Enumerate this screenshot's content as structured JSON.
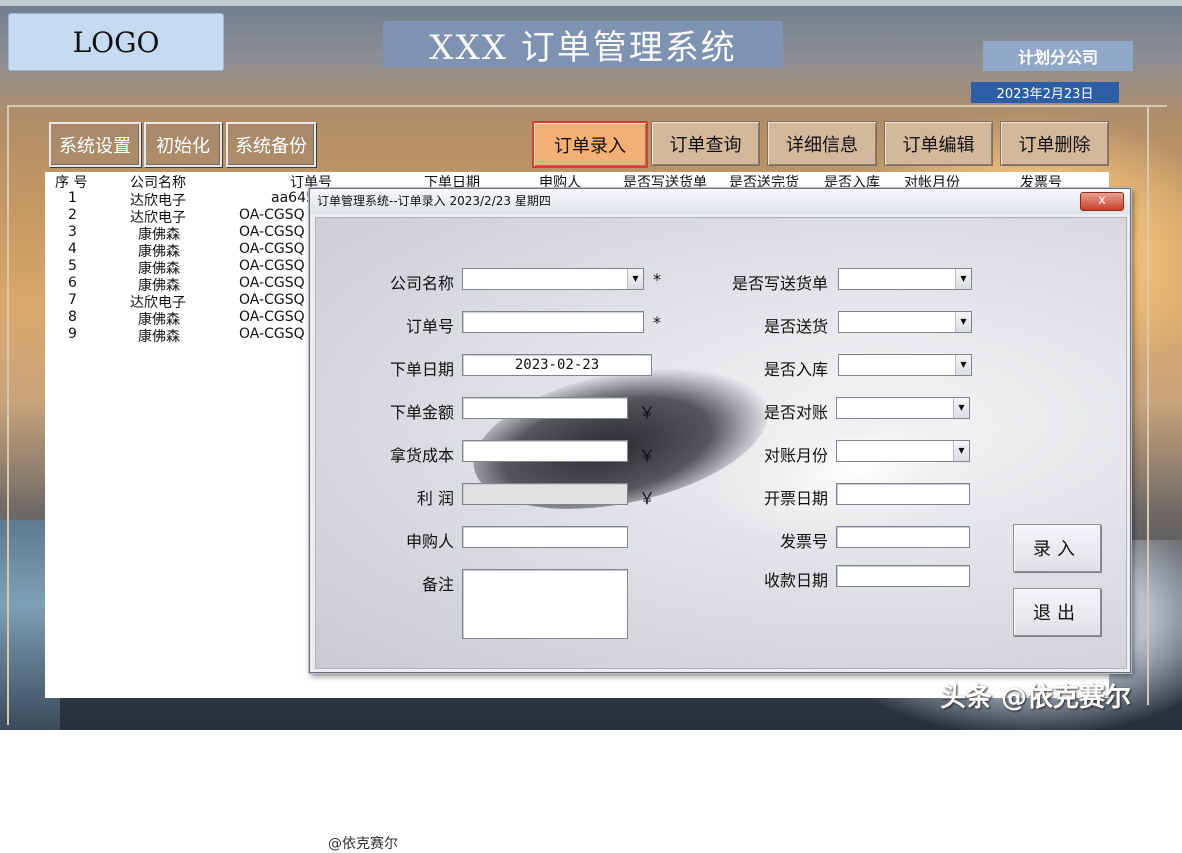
{
  "header": {
    "logo": "LOGO",
    "title": "XXX 订单管理系统",
    "company": "计划分公司",
    "date": "2023年2月23日"
  },
  "toolbar": {
    "left": [
      "系统设置",
      "初始化",
      "系统备份"
    ],
    "right": [
      "订单录入",
      "订单查询",
      "详细信息",
      "订单编辑",
      "订单删除"
    ],
    "active": "订单录入"
  },
  "list": {
    "columns": [
      "序 号",
      "公司名称",
      "订单号",
      "下单日期",
      "申购人",
      "是否写送货单",
      "是否送完货",
      "是否入库",
      "对帐月份",
      "发票号"
    ],
    "rows": [
      {
        "no": "1",
        "company": "达欣电子",
        "order": "aa645"
      },
      {
        "no": "2",
        "company": "达欣电子",
        "order": "OA-CGSQ"
      },
      {
        "no": "3",
        "company": "康佛森",
        "order": "OA-CGSQ"
      },
      {
        "no": "4",
        "company": "康佛森",
        "order": "OA-CGSQ"
      },
      {
        "no": "5",
        "company": "康佛森",
        "order": "OA-CGSQ"
      },
      {
        "no": "6",
        "company": "康佛森",
        "order": "OA-CGSQ"
      },
      {
        "no": "7",
        "company": "达欣电子",
        "order": "OA-CGSQ"
      },
      {
        "no": "8",
        "company": "康佛森",
        "order": "OA-CGSQ"
      },
      {
        "no": "9",
        "company": "康佛森",
        "order": "OA-CGSQ"
      }
    ]
  },
  "dialog": {
    "title": "订单管理系统--订单录入 2023/2/23 星期四",
    "close": "x",
    "left_fields": {
      "company": "公司名称",
      "order_no": "订单号",
      "order_date": "下单日期",
      "order_date_value": "2023-02-23",
      "amount": "下单金额",
      "cost": "拿货成本",
      "profit": "利 润",
      "buyer": "申购人",
      "remark": "备注"
    },
    "required_mark": "*",
    "currency": "￥",
    "right_fields": {
      "delivery_note": "是否写送货单",
      "delivered": "是否送货",
      "stocked": "是否入库",
      "reconciled": "是否对账",
      "recon_month": "对账月份",
      "invoice_date": "开票日期",
      "invoice_no": "发票号",
      "payment_date": "收款日期"
    },
    "buttons": {
      "submit": "录入",
      "exit": "退出"
    },
    "credit": "@依克赛尔"
  },
  "watermark": "头条 @依克赛尔"
}
